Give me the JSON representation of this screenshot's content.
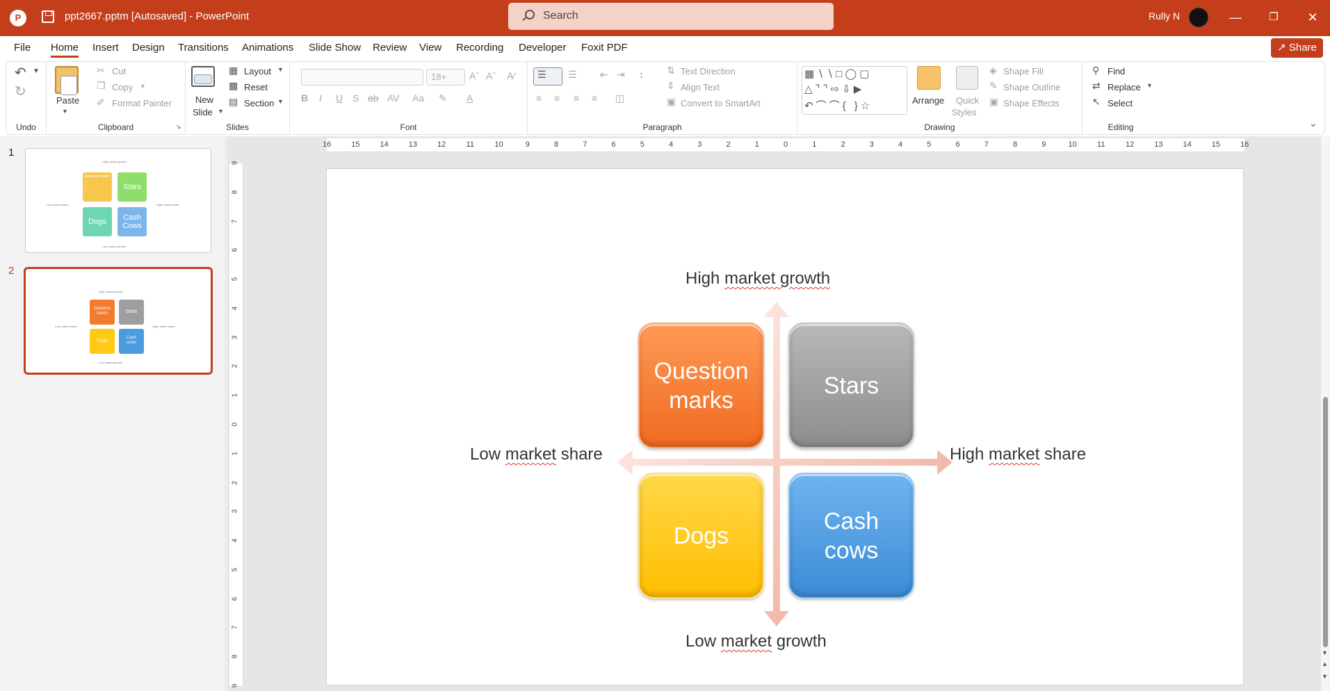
{
  "app": {
    "doc_title": "ppt2667.pptm [Autosaved]  -  PowerPoint",
    "search_placeholder": "Search",
    "user_name": "Rully N",
    "share_label": "Share"
  },
  "menu": [
    "File",
    "Home",
    "Insert",
    "Design",
    "Transitions",
    "Animations",
    "Slide Show",
    "Review",
    "View",
    "Recording",
    "Developer",
    "Foxit PDF"
  ],
  "ribbon": {
    "undo": {
      "label": "Undo"
    },
    "clipboard": {
      "paste": "Paste",
      "cut": "Cut",
      "copy": "Copy",
      "format_painter": "Format Painter",
      "label": "Clipboard"
    },
    "slides": {
      "new_slide_1": "New",
      "new_slide_2": "Slide",
      "layout": "Layout",
      "reset": "Reset",
      "section": "Section",
      "label": "Slides"
    },
    "font": {
      "size": "18+",
      "label": "Font"
    },
    "paragraph": {
      "text_direction": "Text Direction",
      "align_text": "Align Text",
      "convert_smartart": "Convert to SmartArt",
      "label": "Paragraph"
    },
    "drawing": {
      "arrange": "Arrange",
      "quick_1": "Quick",
      "quick_2": "Styles",
      "shape_fill": "Shape Fill",
      "shape_outline": "Shape Outline",
      "shape_effects": "Shape Effects",
      "label": "Drawing"
    },
    "editing": {
      "find": "Find",
      "replace": "Replace",
      "select": "Select",
      "label": "Editing"
    }
  },
  "ruler": {
    "h_ticks": [
      "16",
      "15",
      "14",
      "13",
      "12",
      "11",
      "10",
      "9",
      "8",
      "7",
      "6",
      "5",
      "4",
      "3",
      "2",
      "1",
      "0",
      "1",
      "2",
      "3",
      "4",
      "5",
      "6",
      "7",
      "8",
      "9",
      "10",
      "11",
      "12",
      "13",
      "14",
      "15",
      "16"
    ],
    "v_ticks": [
      "9",
      "8",
      "7",
      "6",
      "5",
      "4",
      "3",
      "2",
      "1",
      "0",
      "1",
      "2",
      "3",
      "4",
      "5",
      "6",
      "7",
      "8",
      "9"
    ]
  },
  "thumbnails": [
    {
      "num": "1",
      "top": "High market growth",
      "bottom": "Low market growth",
      "left": "Low market share",
      "right": "High market share",
      "q1": "Question marks",
      "q1_items": [
        "• ...",
        "• ...",
        "• ..."
      ],
      "q2": "Stars",
      "q3": "Dogs",
      "q4a": "Cash",
      "q4b": "Cows"
    },
    {
      "num": "2",
      "top": "High market growth",
      "bottom": "Low market growth",
      "left": "Low market share",
      "right": "High market share",
      "q1": "Question marks",
      "q2": "Stars",
      "q3": "Dogs",
      "q4a": "Cash",
      "q4b": "cows"
    }
  ],
  "slide": {
    "top_label": {
      "pre": "High ",
      "sq": "market growth",
      "post": ""
    },
    "bottom_label": {
      "pre": "Low ",
      "sq": "market",
      "post": " growth"
    },
    "left_label": {
      "pre": "Low ",
      "sq": "market",
      "post": " share"
    },
    "right_label": {
      "pre": "High ",
      "sq": "market",
      "post": " share"
    },
    "q1_line1": "Question",
    "q1_line2": "marks",
    "q2": "Stars",
    "q3": "Dogs",
    "q4_line1": "Cash",
    "q4_line2": "cows"
  },
  "colors": {
    "accent": "#c43e1c",
    "orange": "#f47a2e",
    "gray": "#9e9e9e",
    "yellow": "#ffc914",
    "blue": "#4a9be0",
    "arrow": "#f6cfc3"
  }
}
